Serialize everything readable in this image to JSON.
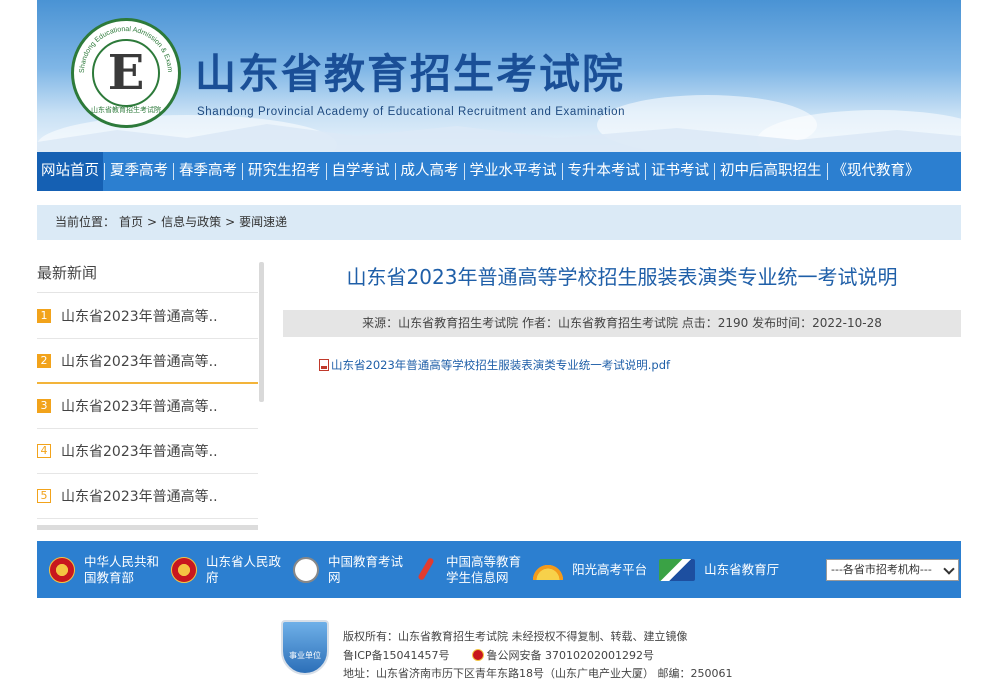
{
  "banner": {
    "title": "山东省教育招生考试院",
    "subtitle": "Shandong Provincial Academy of Educational Recruitment and Examination",
    "logo_letter": "E",
    "logo_ring_text": "Shandong Educational Admission & Examinations",
    "logo_bottom_text": "山东省教育招生考试院"
  },
  "nav": {
    "items": [
      "网站首页",
      "夏季高考",
      "春季高考",
      "研究生招考",
      "自学考试",
      "成人高考",
      "学业水平考试",
      "专升本考试",
      "证书考试",
      "初中后高职招生",
      "《现代教育》"
    ]
  },
  "breadcrumb": {
    "label": "当前位置：",
    "home": "首页",
    "sep1": ">",
    "level1": "信息与政策",
    "sep2": ">",
    "level2": "要闻速递"
  },
  "sidebar": {
    "title": "最新新闻",
    "items": [
      {
        "num": "1",
        "text": "山东省2023年普通高等.."
      },
      {
        "num": "2",
        "text": "山东省2023年普通高等.."
      },
      {
        "num": "3",
        "text": "山东省2023年普通高等.."
      },
      {
        "num": "4",
        "text": "山东省2023年普通高等.."
      },
      {
        "num": "5",
        "text": "山东省2023年普通高等.."
      }
    ]
  },
  "article": {
    "title": "山东省2023年普通高等学校招生服装表演类专业统一考试说明",
    "meta": "来源：山东省教育招生考试院 作者：山东省教育招生考试院 点击：2190 发布时间：2022-10-28",
    "attachment": "山东省2023年普通高等学校招生服装表演类专业统一考试说明.pdf"
  },
  "links": {
    "items": [
      {
        "line1": "中华人民共和",
        "line2": "国教育部",
        "icon": "national-emblem-icon"
      },
      {
        "line1": "山东省人民政",
        "line2": "府",
        "icon": "national-emblem-icon"
      },
      {
        "line1": "中国教育考试",
        "line2": "网",
        "icon": "exam-logo-icon"
      },
      {
        "line1": "中国高等教育",
        "line2": "学生信息网",
        "icon": "rocket-logo-icon"
      },
      {
        "line1": "阳光高考平台",
        "line2": "",
        "icon": "sunrise-icon"
      },
      {
        "line1": "山东省教育厅",
        "line2": "",
        "icon": "edu-dept-icon"
      }
    ],
    "select_value": "---各省市招考机构---"
  },
  "footer": {
    "badge": "事业单位",
    "copyright": "版权所有：山东省教育招生考试院 未经授权不得复制、转载、建立镜像",
    "icp": "鲁ICP备15041457号",
    "police": "鲁公网安备 37010202001292号",
    "address": "地址：山东省济南市历下区青年东路18号（山东广电产业大厦） 邮编：250061"
  },
  "colors": {
    "nav_blue": "#2c7fd0",
    "title_blue": "#1f5fa8",
    "number_orange": "#f2a31b"
  }
}
